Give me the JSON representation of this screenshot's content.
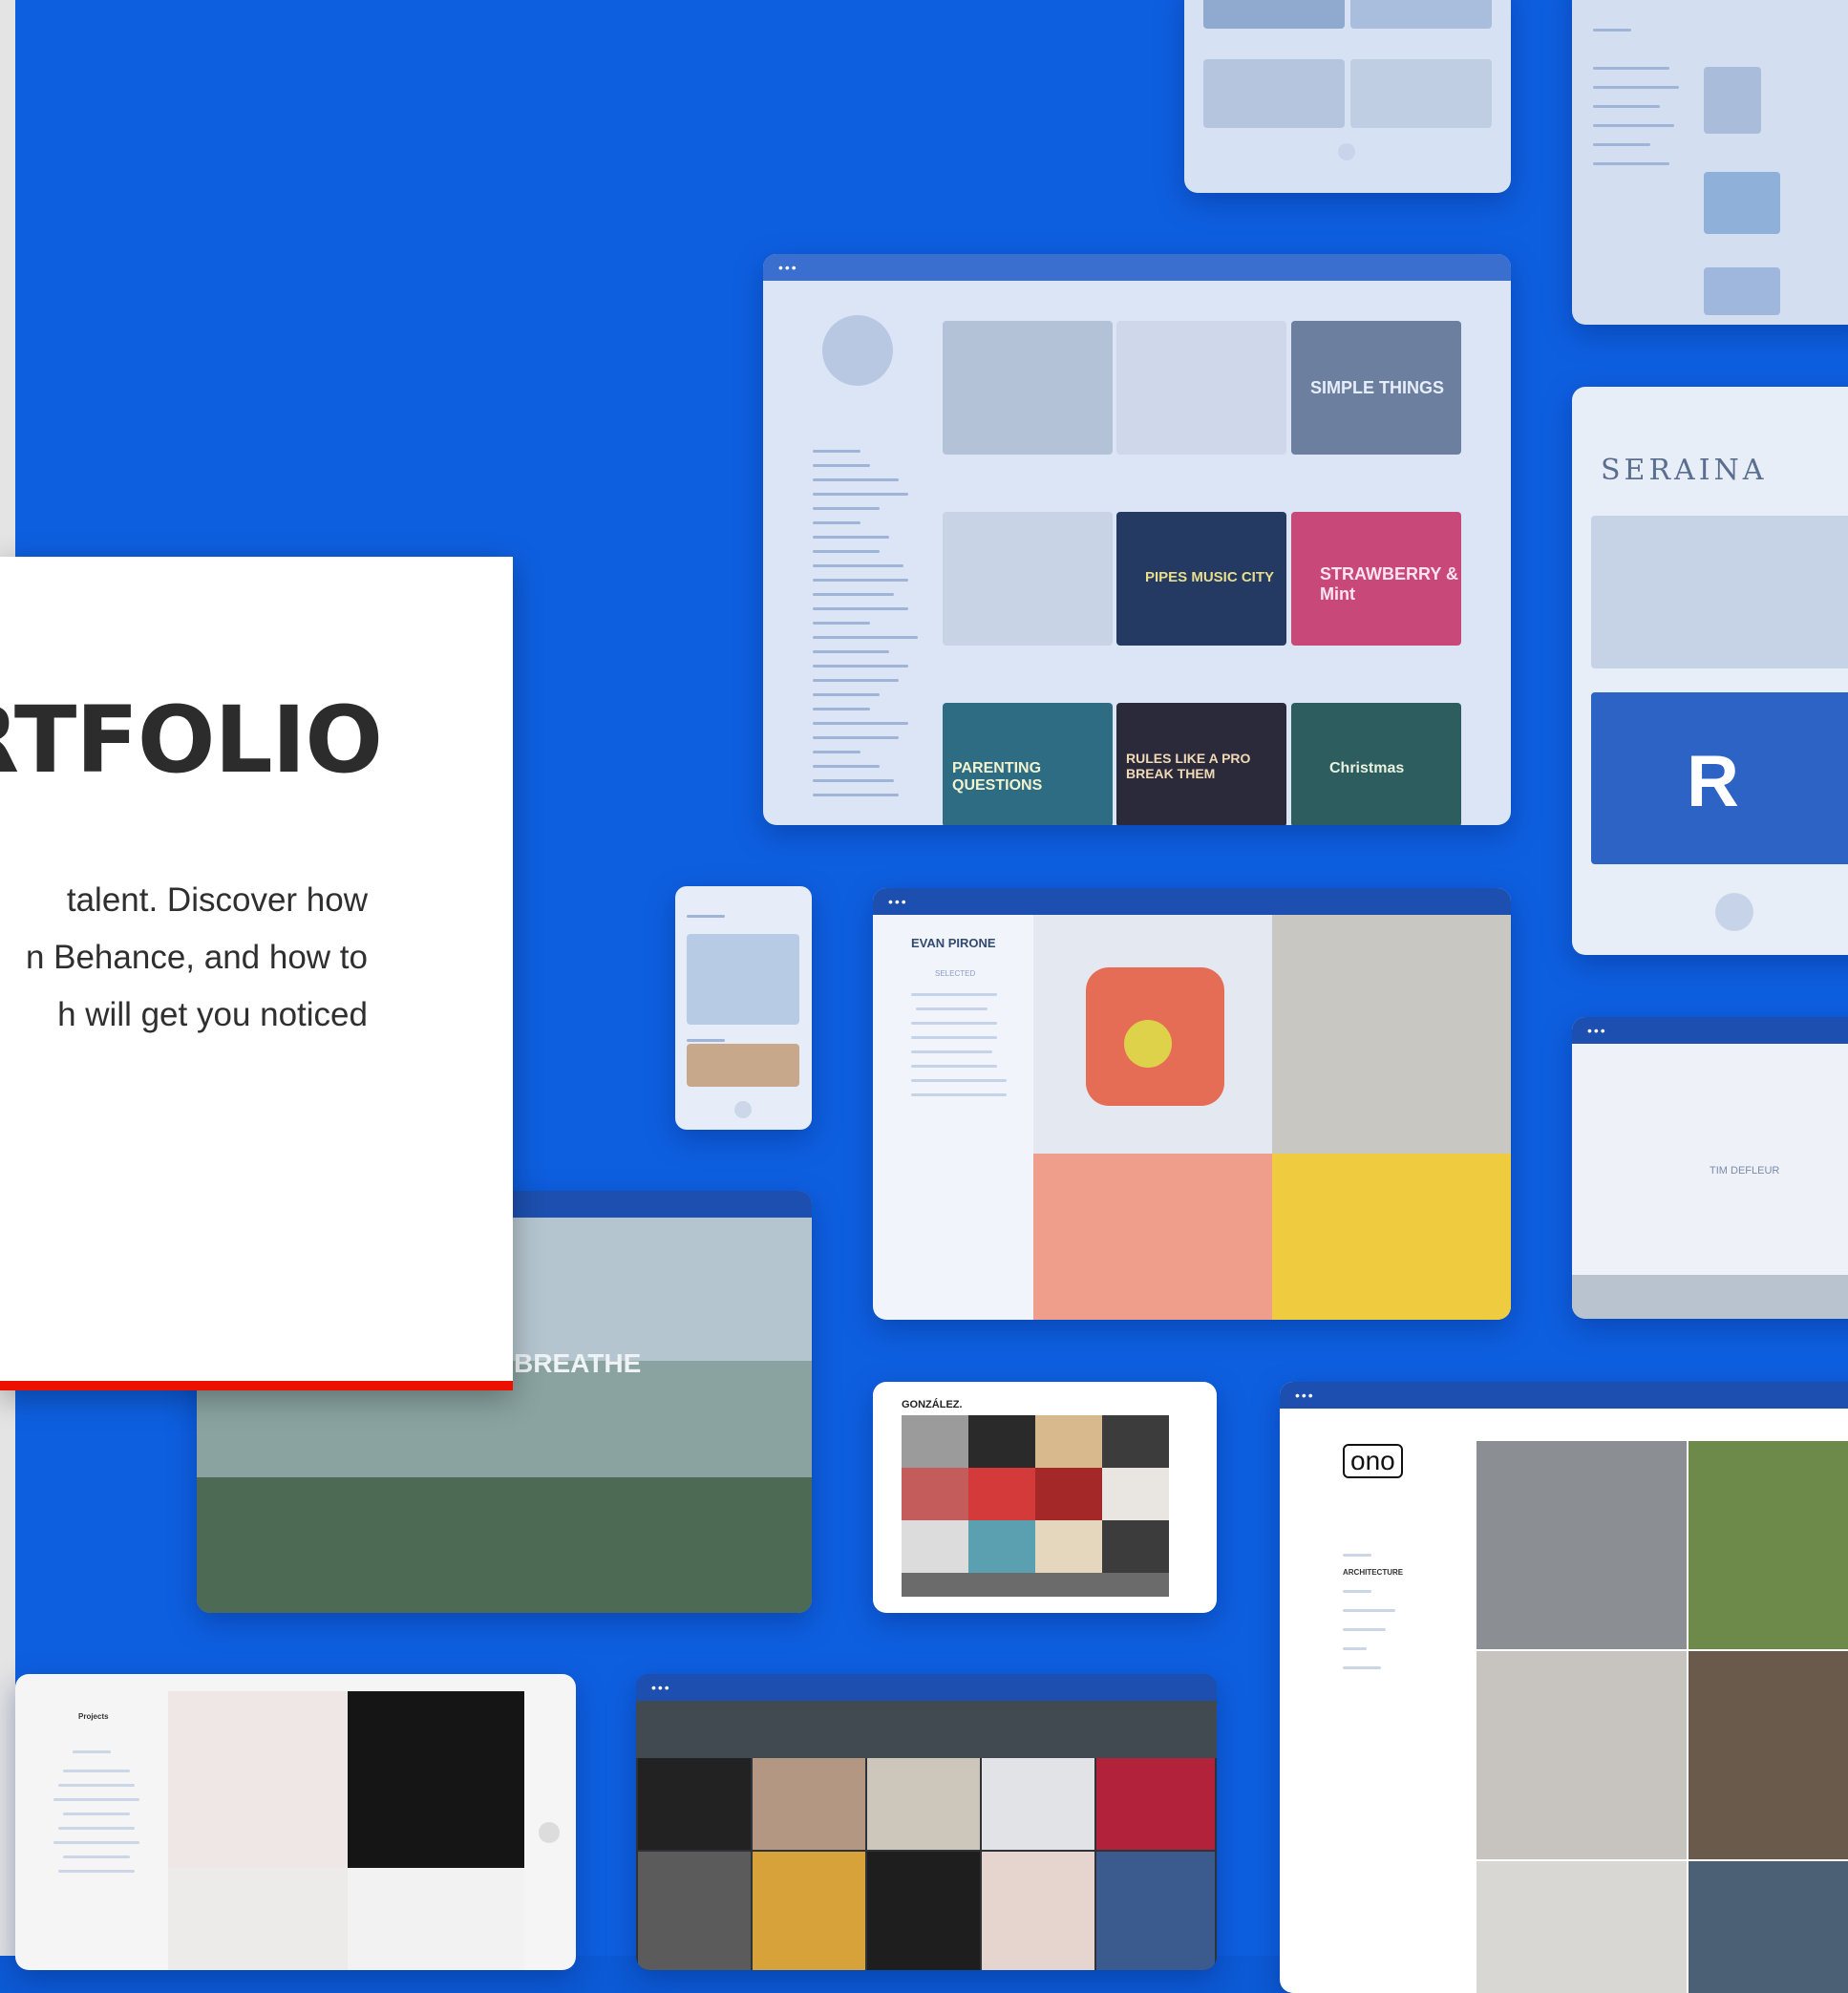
{
  "card": {
    "heading": "RTFOLIO",
    "description_lines": [
      "talent. Discover how",
      "n Behance, and how to",
      "h will get you noticed"
    ]
  },
  "mockups": {
    "evan": {
      "name": "EVAN PIRONE",
      "menu_title": "SELECTED"
    },
    "seraina": {
      "brand": "SERAINA",
      "monogram": "R"
    },
    "lettering": {
      "tiles": [
        "SIMPLE THINGS",
        "PIPES MUSIC CITY",
        "STRAWBERRY & Mint",
        "PARENTING QUESTIONS",
        "RULES LIKE A PRO BREAK THEM",
        "Christmas"
      ]
    },
    "architecture": {
      "overlay": "BREATHE"
    },
    "gonzalez": {
      "name": "GONZÁLEZ."
    },
    "ono": {
      "logo": "ono",
      "nav_active": "ARCHITECTURE"
    },
    "tim": {
      "name": "TIM DEFLEUR"
    },
    "projects_list": {
      "title": "Projects"
    }
  },
  "colors": {
    "background": "#0e5fe0",
    "accent": "#eb1000",
    "card": "#ffffff",
    "heading": "#2c2c2c"
  }
}
